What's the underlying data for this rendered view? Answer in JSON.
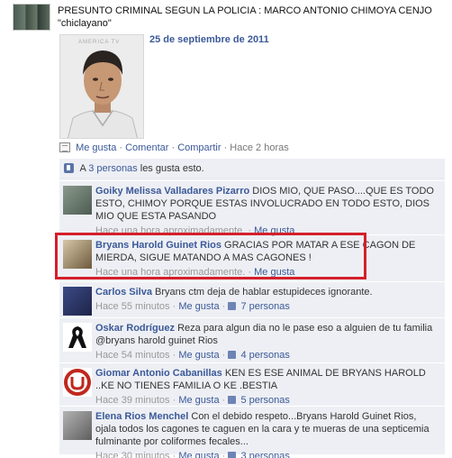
{
  "post": {
    "text": "PRESUNTO CRIMINAL SEGUN LA POLICIA : MARCO ANTONIO CHIMOYA CENJO \"chiclayano\"",
    "photo_watermark": "AMERICA TV",
    "photo_date": "25 de septiembre de 2011"
  },
  "actions": {
    "like": "Me gusta",
    "comment": "Comentar",
    "share": "Compartir",
    "time": "Hace 2 horas",
    "sep": "·"
  },
  "likes_summary": {
    "prefix": "A",
    "people": "3 personas",
    "suffix": "les gusta esto."
  },
  "comments": [
    {
      "author": "Goiky Melissa Valladares Pizarro",
      "text": "DIOS MIO, QUE PASO....QUE ES TODO ESTO, CHIMOY PORQUE ESTAS INVOLUCRADO EN TODO ESTO, DIOS MIO QUE ESTA PASANDO",
      "time": "Hace una hora aproximadamente.",
      "like": "Me gusta",
      "likes_count": ""
    },
    {
      "author": "Bryans Harold Guinet Rios",
      "text": "GRACIAS POR MATAR A ESE CAGON DE MIERDA, SIGUE MATANDO A MAS CAGONES !",
      "time": "Hace una hora aproximadamente.",
      "like": "Me gusta",
      "likes_count": ""
    },
    {
      "author": "Carlos Silva",
      "text": "Bryans ctm deja de hablar estupideces ignorante.",
      "time": "Hace 55 minutos",
      "like": "Me gusta",
      "likes_count": "7 personas"
    },
    {
      "author": "Oskar Rodríguez",
      "text": "Reza para algun dia no le pase eso a alguien de tu familia @bryans harold guinet Rios",
      "time": "Hace 54 minutos",
      "like": "Me gusta",
      "likes_count": "4 personas"
    },
    {
      "author": "Giomar Antonio Cabanillas",
      "text": "KEN ES ESE ANIMAL DE BRYANS HAROLD ..KE NO TIENES FAMILIA O KE .BESTIA",
      "time": "Hace 39 minutos",
      "like": "Me gusta",
      "likes_count": "5 personas"
    },
    {
      "author": "Elena Rios Menchel",
      "text": "Con el debido respeto...Bryans Harold Guinet Rios, ojala todos los cagones te caguen en la cara y te mueras de una septicemia fulminante por coliformes fecales...",
      "time": "Hace 30 minutos",
      "like": "Me gusta",
      "likes_count": "3 personas"
    }
  ],
  "colors": {
    "link": "#3b5998",
    "ufi_background": "#edeff4",
    "highlight_border": "#d41f2a"
  }
}
